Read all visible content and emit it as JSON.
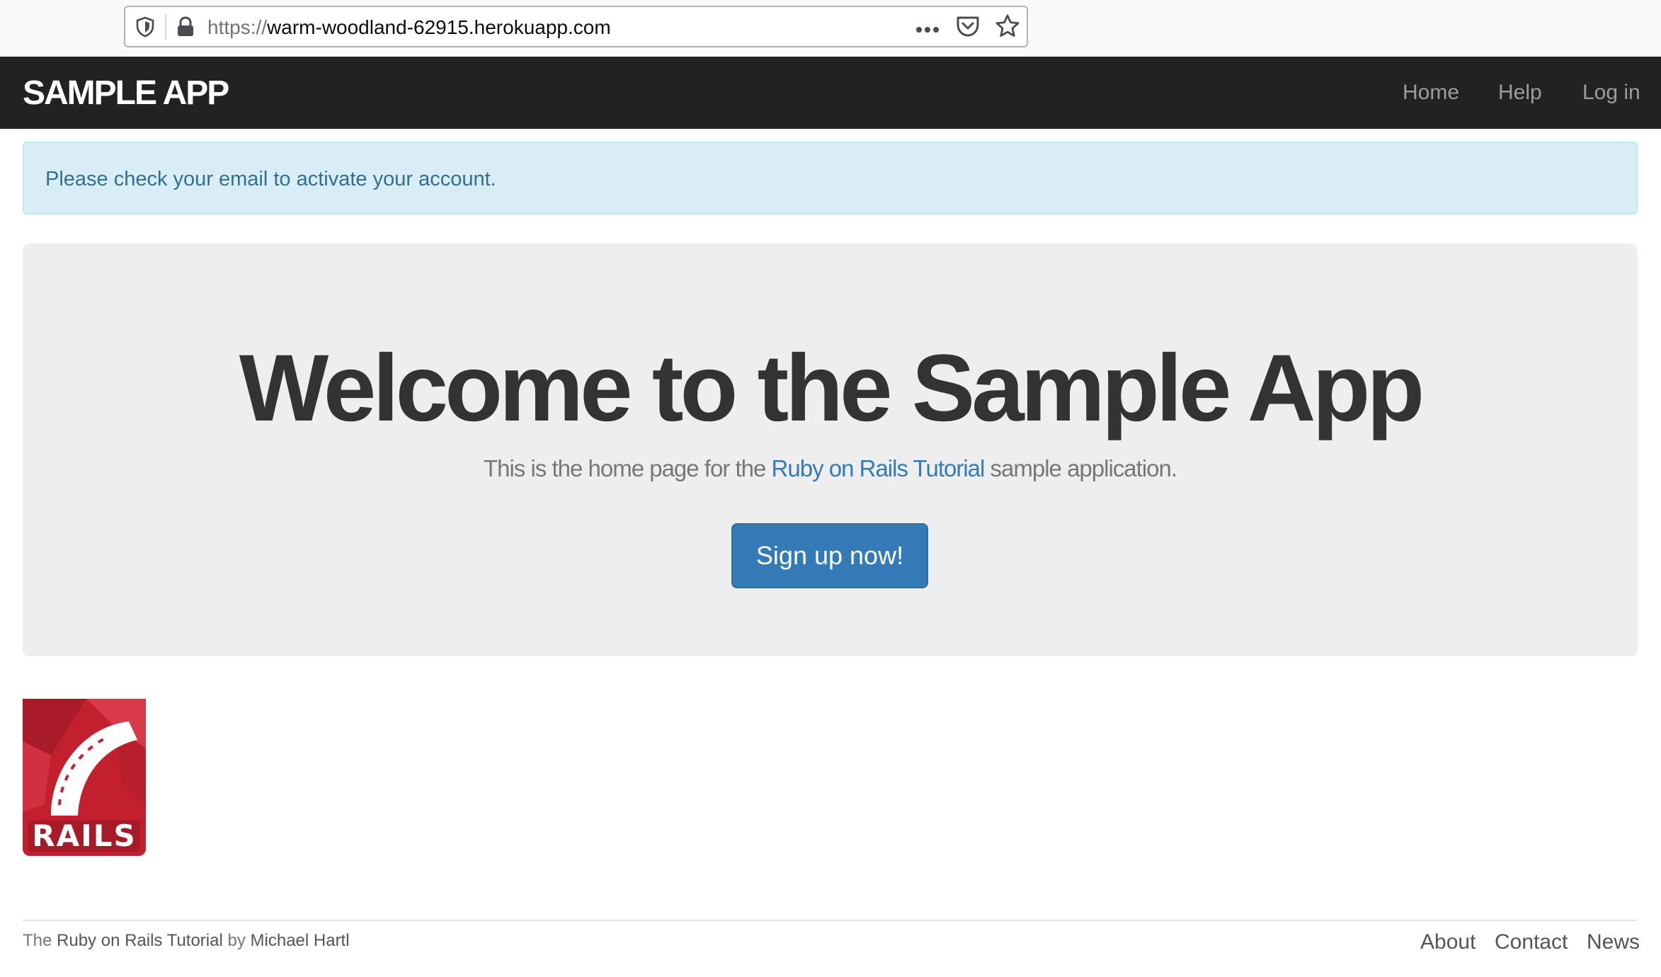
{
  "browser": {
    "url_scheme": "https://",
    "url_host": "warm-woodland-62915.herokuapp.com",
    "icons": [
      "shield-icon",
      "lock-icon",
      "more-icon",
      "pocket-icon",
      "bookmark-star-icon"
    ]
  },
  "navbar": {
    "brand": "SAMPLE APP",
    "links": [
      {
        "label": "Home"
      },
      {
        "label": "Help"
      },
      {
        "label": "Log in"
      }
    ]
  },
  "flash": {
    "type": "info",
    "message": "Please check your email to activate your account."
  },
  "hero": {
    "title": "Welcome to the Sample App",
    "subtitle_before": "This is the home page for the",
    "subtitle_link": "Ruby on Rails Tutorial",
    "subtitle_after": "sample application.",
    "button_label": "Sign up now!"
  },
  "logo": {
    "label": "RAILS"
  },
  "footer": {
    "prefix": "The",
    "tutorial_link": "Ruby on Rails Tutorial",
    "by": "by",
    "author_link": "Michael Hartl",
    "links": [
      {
        "label": "About"
      },
      {
        "label": "Contact"
      },
      {
        "label": "News"
      }
    ]
  },
  "colors": {
    "navbar_bg": "#222222",
    "nav_link": "#9d9d9d",
    "alert_bg": "#d9edf7",
    "alert_text": "#31708f",
    "jumbotron_bg": "#eeeeee",
    "primary": "#337ab7",
    "rails_red": "#c3202f"
  }
}
